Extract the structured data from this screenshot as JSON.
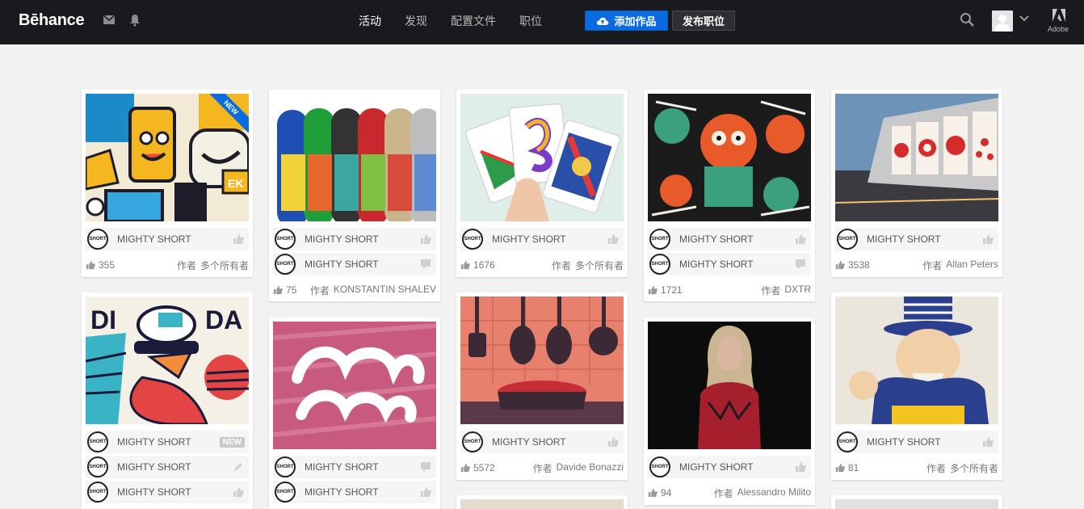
{
  "header": {
    "logo": "Bēhance",
    "nav": [
      "活动",
      "发现",
      "配置文件",
      "职位"
    ],
    "add_project": "添加作品",
    "post_job": "发布职位",
    "adobe_label": "Adobe"
  },
  "labels": {
    "by": "作者",
    "new": "NEW"
  },
  "colors": {
    "topbar": "#191a1d",
    "accent": "#0a6be0",
    "page_bg": "#f2f2f2"
  },
  "cards": [
    {
      "owners": [
        {
          "name": "MIGHTY SHORT",
          "icon": "thumb-up-icon"
        }
      ],
      "appreciations": "355",
      "author": "多个所有者",
      "new": true
    },
    {
      "owners": [
        {
          "name": "MIGHTY SHORT",
          "icon": "thumb-up-icon"
        },
        {
          "name": "MIGHTY SHORT",
          "icon": "comment-icon"
        }
      ],
      "appreciations": "75",
      "author": "KONSTANTIN SHALEV"
    },
    {
      "owners": [
        {
          "name": "MIGHTY SHORT",
          "icon": "thumb-up-icon"
        }
      ],
      "appreciations": "1676",
      "author": "多个所有者"
    },
    {
      "owners": [
        {
          "name": "MIGHTY SHORT",
          "icon": "thumb-up-icon"
        },
        {
          "name": "MIGHTY SHORT",
          "icon": "comment-icon"
        }
      ],
      "appreciations": "1721",
      "author": "DXTR"
    },
    {
      "owners": [
        {
          "name": "MIGHTY SHORT",
          "icon": "thumb-up-icon"
        }
      ],
      "appreciations": "3538",
      "author": "Allan Peters"
    },
    {
      "owners": [
        {
          "name": "MIGHTY SHORT",
          "icon": "new-badge"
        },
        {
          "name": "MIGHTY SHORT",
          "icon": "pencil-icon"
        },
        {
          "name": "MIGHTY SHORT",
          "icon": "thumb-up-icon"
        }
      ]
    },
    {
      "owners": [
        {
          "name": "MIGHTY SHORT",
          "icon": "comment-icon"
        },
        {
          "name": "MIGHTY SHORT",
          "icon": "thumb-up-icon"
        }
      ]
    },
    {
      "owners": [
        {
          "name": "MIGHTY SHORT",
          "icon": "thumb-up-icon"
        }
      ],
      "appreciations": "5572",
      "author": "Davide Bonazzi"
    },
    {
      "owners": [
        {
          "name": "MIGHTY SHORT",
          "icon": "thumb-up-icon"
        }
      ],
      "appreciations": "94",
      "author": "Alessandro Milito"
    },
    {
      "owners": [
        {
          "name": "MIGHTY SHORT",
          "icon": "thumb-up-icon"
        }
      ],
      "appreciations": "81",
      "author": "多个所有者"
    }
  ]
}
